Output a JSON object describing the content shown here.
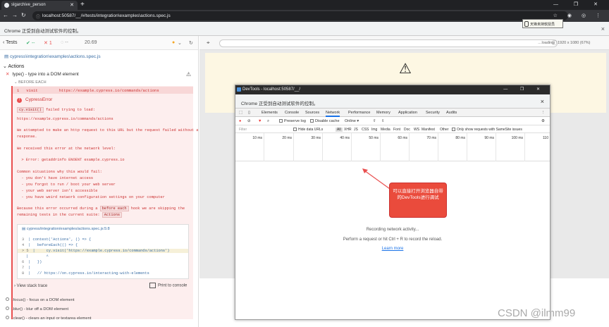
{
  "browser": {
    "tab_title": "slgarchive_person",
    "new_tab": "+",
    "window_controls": "— ❐ ✕",
    "address": "localhost:50587/__/#/tests/integration\\examples\\actions.spec.js",
    "infobar": "Chrome 正受到自动测试软件的控制。",
    "stamp_text": "天锋未持软授员"
  },
  "runner": {
    "tests_label": "Tests",
    "passed": "--",
    "failed": "1",
    "pending": "--",
    "duration": "20.69",
    "spec_path": "cypress\\integration\\examples\\actions.spec.js",
    "suite_title": "Actions",
    "failed_test": "type() - type into a DOM element",
    "before_each": "BEFORE EACH",
    "command": {
      "num": "1",
      "name": "visit",
      "url": "https://example.cypress.io/commands/actions"
    },
    "error_name": "CypressError",
    "error_lines": [
      {
        "code": "cy.visit()",
        "text": " failed trying to load:"
      },
      {
        "text": "https://example.cypress.io/commands/actions"
      },
      {
        "text": "We attempted to make an http request to this URL but the request failed without a"
      },
      {
        "text": "response."
      },
      {
        "text": "We received this error at the network level:"
      },
      {
        "text": "  > Error: getaddrinfo ENOENT example.cypress.io"
      },
      {
        "text": "Common situations why this would fail:"
      },
      {
        "text": "  - you don't have internet access"
      },
      {
        "text": "  - you forgot to run / boot your web server"
      },
      {
        "text": "  - your web server isn't accessible"
      },
      {
        "text": "  - you have weird network configuration settings on your computer"
      },
      {
        "text": "Because this error occurred during a ",
        "code": "before each",
        "tail": " hook we are skipping the"
      },
      {
        "text": "remaining tests in the current suite: ",
        "code": "Actions"
      }
    ],
    "code_frame": {
      "path": "cypress/integration/examples/actions.spec.js:5:8",
      "lines": [
        {
          "n": "3",
          "t": "| context('Actions', () => {"
        },
        {
          "n": "4",
          "t": "|   beforeEach(() => {"
        },
        {
          "n": "> 5",
          "t": "|     cy.visit('https://example.cypress.io/commands/actions')"
        },
        {
          "n": "",
          "t": "|        ^"
        },
        {
          "n": "6",
          "t": "|   })"
        },
        {
          "n": "7",
          "t": "|"
        },
        {
          "n": "8",
          "t": "|   // https://on.cypress.io/interacting-with-elements"
        }
      ]
    },
    "view_stack": "View stack trace",
    "print_console": "Print to console",
    "other_tests": [
      ".focus() - focus on a DOM element",
      ".blur() - blur off a DOM element",
      ".clear() - clears an input or textarea element"
    ],
    "viewport_info": "1920 x 1080 (67%)",
    "loading": "loading"
  },
  "devtools": {
    "title": "DevTools - localhost:50587/__/",
    "infobar": "Chrome 正受到自动测试软件的控制。",
    "tabs": [
      "Elements",
      "Console",
      "Sources",
      "Network",
      "Performance",
      "Memory",
      "Application",
      "Security",
      "Audits"
    ],
    "active_tab": "Network",
    "toolbar": {
      "preserve_log": "Preserve log",
      "disable_cache": "Disable cache",
      "throttle": "Online"
    },
    "filter": {
      "placeholder": "Filter",
      "hide_data_urls": "Hide data URLs",
      "types": [
        "All",
        "XHR",
        "JS",
        "CSS",
        "Img",
        "Media",
        "Font",
        "Doc",
        "WS",
        "Manifest",
        "Other"
      ],
      "samesite": "Only show requests with SameSite issues"
    },
    "ticks": [
      "10 ms",
      "20 ms",
      "30 ms",
      "40 ms",
      "50 ms",
      "60 ms",
      "70 ms",
      "80 ms",
      "90 ms",
      "100 ms",
      "110"
    ],
    "recording": "Recording network activity...",
    "hint": "Perform a request or hit Ctrl + R to record the reload.",
    "learn_more": "Learn more"
  },
  "annotation": {
    "callout": "可以直接打开浏览器自带的DevTools进行调试"
  },
  "watermark": "CSDN @ilmm99",
  "colors": {
    "error": "#e94f4f",
    "accent": "#1a73e8",
    "callout": "#ea4b3c"
  }
}
